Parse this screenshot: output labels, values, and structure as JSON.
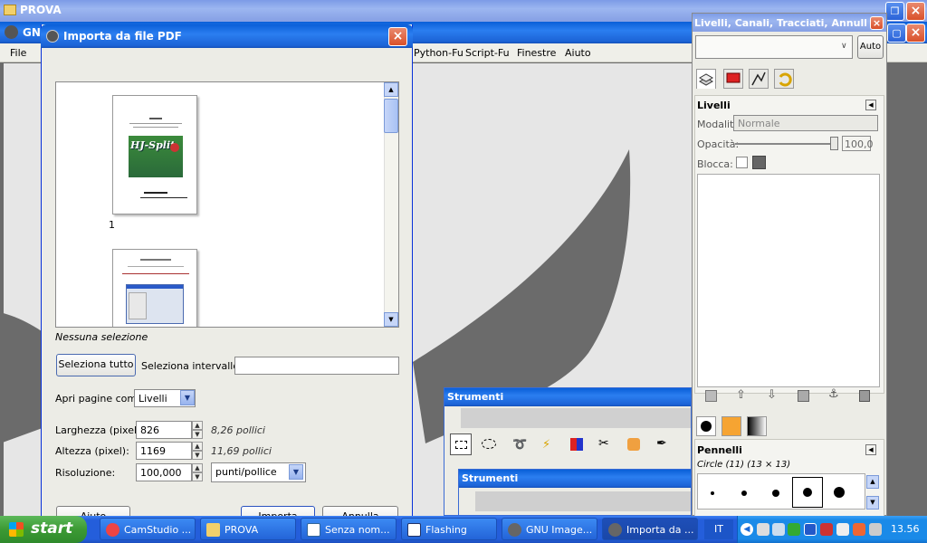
{
  "background_window": {
    "title": "PROVA",
    "gimp_title": "GNU",
    "menu": [
      "File",
      "Python-Fu",
      "Script-Fu",
      "Finestre",
      "Aiuto"
    ]
  },
  "dialog": {
    "title": "Importa da file PDF",
    "page_label": "1",
    "no_selection": "Nessuna selezione",
    "select_all": "Seleziona tutto",
    "select_range_label": "Seleziona intervallo:",
    "select_range_value": "",
    "open_pages_as_label": "Apri pagine come",
    "open_pages_as_value": "Livelli",
    "width_label": "Larghezza (pixel):",
    "width_value": "826",
    "width_inches": "8,26 pollici",
    "height_label": "Altezza (pixel):",
    "height_value": "1169",
    "height_inches": "11,69 pollici",
    "resolution_label": "Risoluzione:",
    "resolution_value": "100,000",
    "resolution_unit": "punti/pollice",
    "help_button": "Aiuto",
    "import_button": "Importa",
    "cancel_button": "Annulla",
    "thumb_logo": "HJ-Split"
  },
  "layers_panel": {
    "title": "Livelli, Canali, Tracciati, Annulla - ...",
    "auto_button": "Auto",
    "section_title": "Livelli",
    "mode_label": "Modalità:",
    "mode_value": "Normale",
    "opacity_label": "Opacità:",
    "opacity_value": "100,0",
    "opacity_fraction": 1.0,
    "lock_label": "Blocca:",
    "brushes_title": "Pennelli",
    "brush_name": "Circle (11) (13 × 13)"
  },
  "toolbox": {
    "title": "Strumenti",
    "title2": "Strumenti"
  },
  "taskbar": {
    "start": "start",
    "items": [
      "CamStudio ...",
      "PROVA",
      "Senza nom...",
      "Flashing",
      "GNU Image...",
      "Importa da ..."
    ],
    "lang": "IT",
    "clock": "13.56"
  },
  "colors": {
    "xp_blue": "#2b7ef0",
    "taskbar": "#245edb",
    "start_green": "#3c9a34",
    "canvas_gray": "#6b6b6b"
  }
}
